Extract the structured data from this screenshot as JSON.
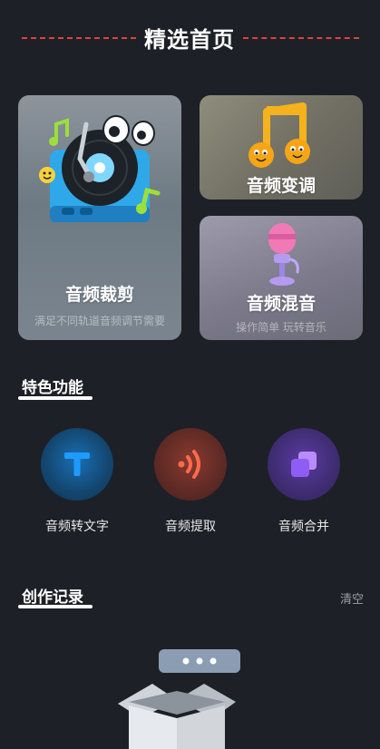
{
  "header": {
    "title": "精选首页",
    "accent_color": "#e0413f"
  },
  "cards": {
    "trim": {
      "title": "音频裁剪",
      "subtitle": "满足不同轨道音频调节需要",
      "icon": "vinyl-record-player-illustration"
    },
    "pitch": {
      "title": "音频变调",
      "icon": "music-note-illustration"
    },
    "mix": {
      "title": "音频混音",
      "subtitle": "操作简单 玩转音乐",
      "icon": "microphone-illustration"
    }
  },
  "features": {
    "title": "特色功能",
    "items": [
      {
        "label": "音频转文字",
        "icon": "text-t-icon",
        "color": "#1e9bff"
      },
      {
        "label": "音频提取",
        "icon": "sound-wave-icon",
        "color": "#ff6a4d"
      },
      {
        "label": "音频合并",
        "icon": "merge-squares-icon",
        "color": "#9d6cff"
      }
    ]
  },
  "history": {
    "title": "创作记录",
    "clear_label": "清空",
    "empty_icon": "empty-box-icon"
  }
}
